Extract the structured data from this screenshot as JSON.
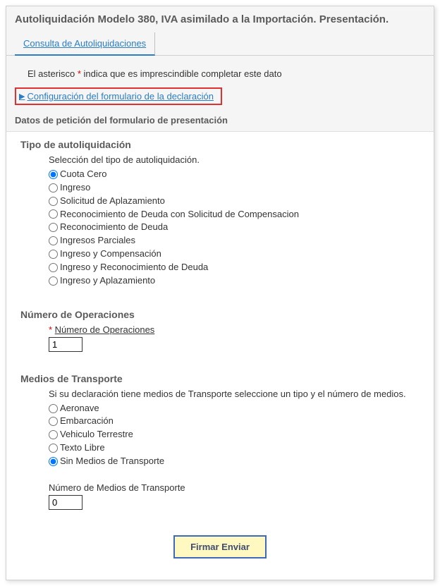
{
  "header": {
    "title": "Autoliquidación Modelo 380, IVA asimilado a la Importación. Presentación."
  },
  "tabs": {
    "consulta": "Consulta de Autoliquidaciones"
  },
  "info": {
    "prefix": "El asterisco ",
    "asterisk": "*",
    "suffix": " indica que es imprescindible completar este dato"
  },
  "config_link": "Configuración del formulario de la declaración",
  "section_header": "Datos de petición del formulario de presentación",
  "tipo": {
    "title": "Tipo de autoliquidación",
    "subtitle": "Selección del tipo de autoliquidación.",
    "options": [
      "Cuota Cero",
      "Ingreso",
      "Solicitud de Aplazamiento",
      "Reconocimiento de Deuda con Solicitud de Compensacion",
      "Reconocimiento de Deuda",
      "Ingresos Parciales",
      "Ingreso y Compensación",
      "Ingreso y Reconocimiento de Deuda",
      "Ingreso y Aplazamiento"
    ],
    "selected": 0
  },
  "num_ops": {
    "title": "Número de Operaciones",
    "label": "Número de Operaciones",
    "value": "1"
  },
  "medios": {
    "title": "Medios de Transporte",
    "subtitle": "Si su declaración tiene medios de Transporte seleccione un tipo y el número de medios.",
    "options": [
      "Aeronave",
      "Embarcación",
      "Vehiculo Terrestre",
      "Texto Libre",
      "Sin Medios de Transporte"
    ],
    "selected": 4,
    "num_label": "Número de Medios de Transporte",
    "num_value": "0"
  },
  "submit": "Firmar Enviar"
}
